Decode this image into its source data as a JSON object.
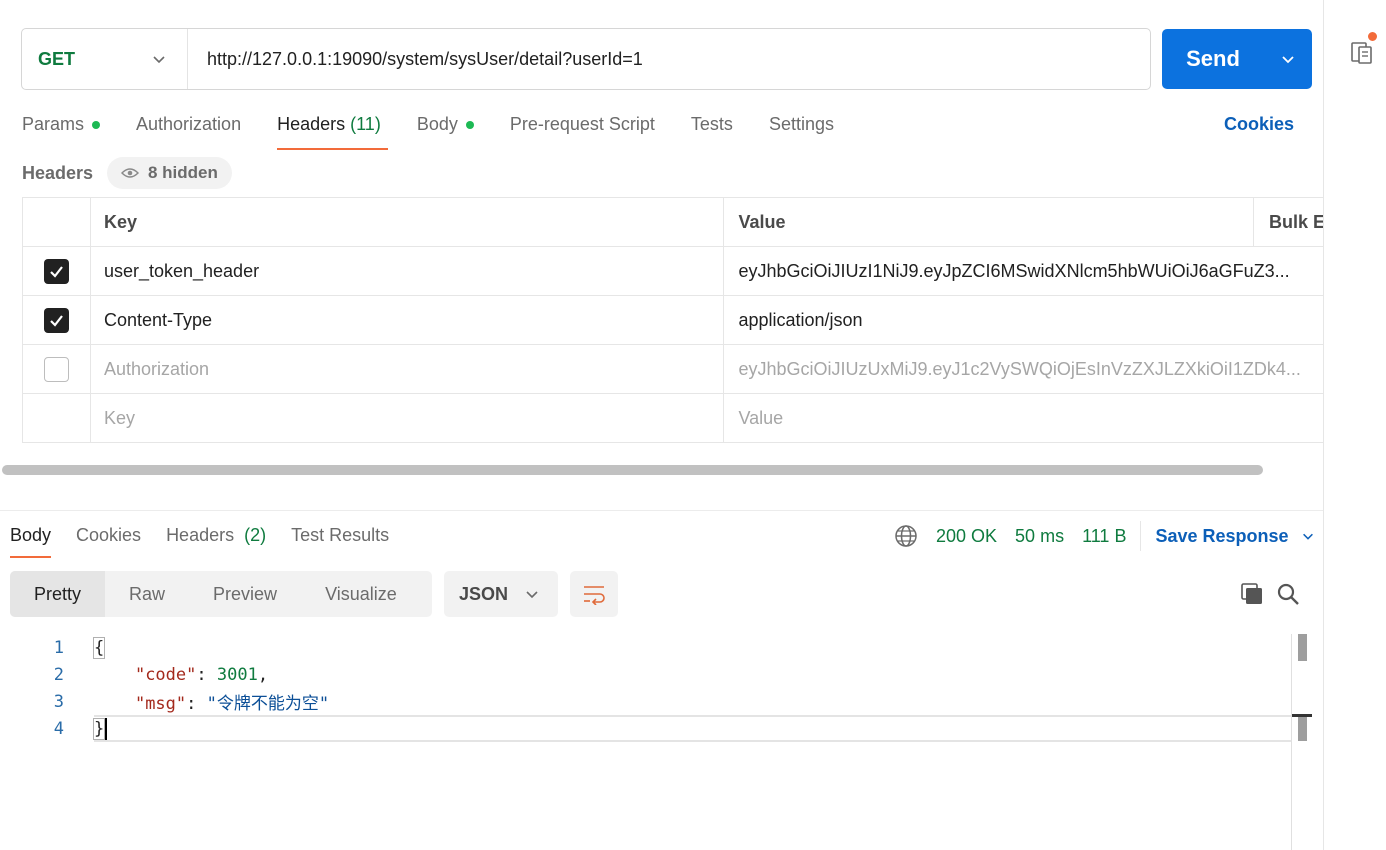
{
  "request": {
    "method": "GET",
    "url": "http://127.0.0.1:19090/system/sysUser/detail?userId=1",
    "send_label": "Send"
  },
  "request_tabs": [
    {
      "label": "Params",
      "indicator": "dot"
    },
    {
      "label": "Authorization"
    },
    {
      "label": "Headers",
      "count": "(11)",
      "active": true
    },
    {
      "label": "Body",
      "indicator": "dot"
    },
    {
      "label": "Pre-request Script"
    },
    {
      "label": "Tests"
    },
    {
      "label": "Settings"
    }
  ],
  "cookies_link": "Cookies",
  "headers_section": {
    "title": "Headers",
    "hidden_label": "8 hidden",
    "columns": {
      "key": "Key",
      "value": "Value",
      "bulk": "Bulk Ed"
    },
    "rows": [
      {
        "checked": true,
        "key": "user_token_header",
        "value": "eyJhbGciOiJIUzI1NiJ9.eyJpZCI6MSwidXNlcm5hbWUiOiJ6aGFuZ3..."
      },
      {
        "checked": true,
        "key": "Content-Type",
        "value": "application/json"
      },
      {
        "checked": false,
        "key": "Authorization",
        "value": "eyJhbGciOiJIUzUxMiJ9.eyJ1c2VySWQiOjEsInVzZXJLZXkiOiI1ZDk4..."
      }
    ],
    "new_row": {
      "key_placeholder": "Key",
      "value_placeholder": "Value"
    }
  },
  "response_tabs": [
    {
      "label": "Body",
      "active": true
    },
    {
      "label": "Cookies"
    },
    {
      "label": "Headers",
      "count": "(2)"
    },
    {
      "label": "Test Results"
    }
  ],
  "response_meta": {
    "status": "200 OK",
    "time": "50 ms",
    "size": "111 B",
    "save_label": "Save Response"
  },
  "view_modes": [
    "Pretty",
    "Raw",
    "Preview",
    "Visualize"
  ],
  "format": "JSON",
  "code_lines": [
    {
      "n": "1",
      "text": "{"
    },
    {
      "n": "2",
      "key": "\"code\"",
      "value": "3001",
      "type": "num"
    },
    {
      "n": "3",
      "key": "\"msg\"",
      "value": "\"令牌不能为空\"",
      "type": "str"
    },
    {
      "n": "4",
      "text": "}"
    }
  ],
  "colors": {
    "send": "#0c72df",
    "method": "#0f7b3f",
    "accent": "#f26b3a",
    "link": "#0c5fb8"
  },
  "icons": [
    "chevron-down-icon",
    "eye-icon",
    "check-icon",
    "globe-icon",
    "wrap-icon",
    "copy-icon",
    "search-icon",
    "document-icon"
  ]
}
